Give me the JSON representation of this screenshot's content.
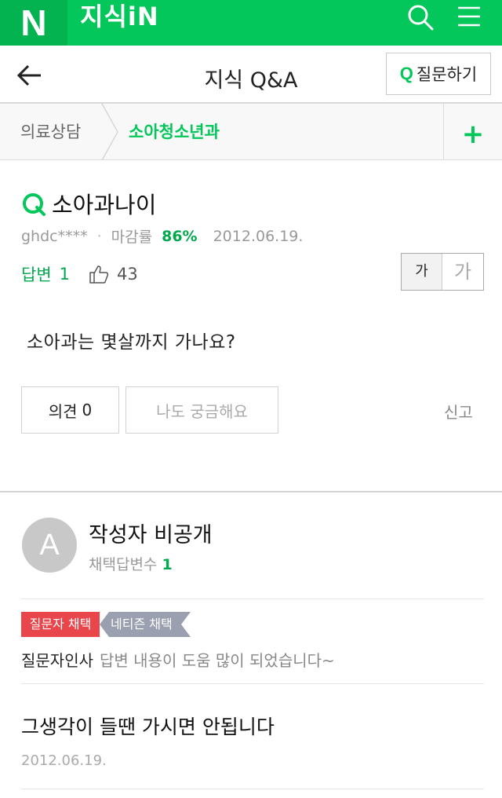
{
  "topbar": {
    "logo": "N",
    "brand": "지식iN",
    "search_icon": "search-icon",
    "menu_icon": "hamburger-menu-icon"
  },
  "header": {
    "title": "지식 Q&A",
    "ask_q": "Q",
    "ask_label": "질문하기"
  },
  "breadcrumb": {
    "parent": "의료상담",
    "current": "소아청소년과",
    "add": "+"
  },
  "question": {
    "q_mark": "Q",
    "title": "소아과나이",
    "author": "ghdc****",
    "dot": "·",
    "close_rate_label": "마감률",
    "close_rate": "86%",
    "date": "2012.06.19.",
    "answers_label": "답변",
    "answers_count": "1",
    "likes": "43",
    "font_small": "가",
    "font_large": "가",
    "body": "소아과는 몇살까지 가나요?",
    "opinion_label": "의견",
    "opinion_count": "0",
    "curious_label": "나도 궁금해요",
    "report_label": "신고"
  },
  "answer": {
    "avatar_letter": "A",
    "author": "작성자 비공개",
    "adopted_label": "채택답변수",
    "adopted_count": "1",
    "badge_asker": "질문자 채택",
    "badge_citizen": "네티즌 채택",
    "thanks_label": "질문자인사",
    "thanks_text": "답변 내용이 도움 많이 되었습니다~",
    "body": "그생각이 들땐 가시면 안됩니다",
    "date": "2012.06.19."
  },
  "colors": {
    "brand_green": "#03c75a",
    "asker_badge": "#e8464b",
    "citizen_badge": "#9aa0b0"
  }
}
